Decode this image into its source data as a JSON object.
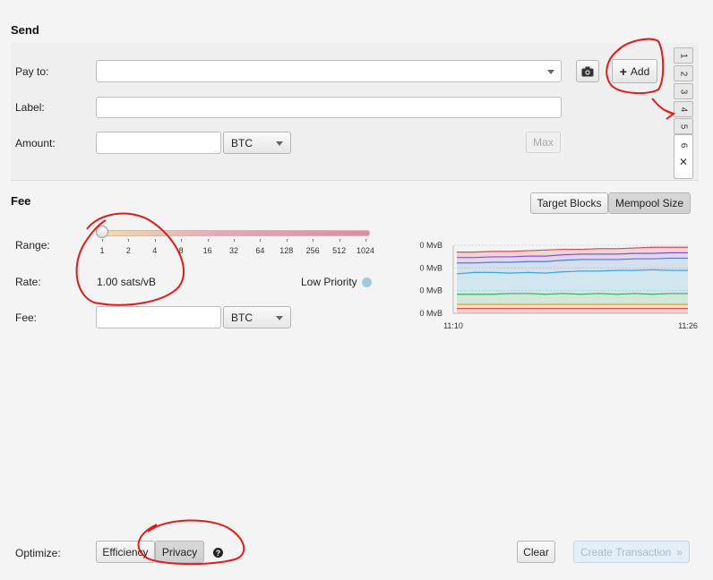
{
  "send": {
    "title": "Send",
    "pay_to_label": "Pay to:",
    "pay_to_value": "",
    "label_label": "Label:",
    "label_value": "",
    "amount_label": "Amount:",
    "amount_value": "",
    "amount_unit": "BTC",
    "max_label": "Max",
    "add_label": "Add",
    "tabs": [
      "1",
      "2",
      "3",
      "4",
      "5",
      "6"
    ],
    "close_symbol": "✕"
  },
  "fee": {
    "title": "Fee",
    "toggle": [
      "Target Blocks",
      "Mempool Size"
    ],
    "toggle_selected": "Mempool Size",
    "range_label": "Range:",
    "range_ticks": [
      "1",
      "2",
      "4",
      "8",
      "16",
      "32",
      "64",
      "128",
      "256",
      "512",
      "1024"
    ],
    "slider_position": 0,
    "rate_label": "Rate:",
    "rate_value": "1.00 sats/vB",
    "priority_label": "Low Priority",
    "priority_color": "#9ecbe0",
    "fee_label": "Fee:",
    "fee_value": "",
    "fee_unit": "BTC"
  },
  "chart_data": {
    "type": "area",
    "y_tick_labels": [
      "0 MvB",
      "0 MvB",
      "0 MvB",
      "0 MvB"
    ],
    "x_tick_labels": [
      "11:10",
      "11:26"
    ],
    "grid": true,
    "series": [
      {
        "color": "#d24d57",
        "values": [
          0.1,
          0.1,
          0.09,
          0.09,
          0.08,
          0.07,
          0.06,
          0.06,
          0.05,
          0.05,
          0.04,
          0.03,
          0.03,
          0.03
        ]
      },
      {
        "color": "#8a4fd0",
        "values": [
          0.18,
          0.18,
          0.17,
          0.17,
          0.16,
          0.16,
          0.14,
          0.13,
          0.13,
          0.13,
          0.12,
          0.12,
          0.11,
          0.11
        ]
      },
      {
        "color": "#4a7fd4",
        "values": [
          0.26,
          0.26,
          0.25,
          0.25,
          0.24,
          0.24,
          0.22,
          0.21,
          0.21,
          0.21,
          0.2,
          0.2,
          0.19,
          0.19
        ]
      },
      {
        "color": "#3aa8d8",
        "values": [
          0.42,
          0.4,
          0.4,
          0.41,
          0.4,
          0.41,
          0.39,
          0.38,
          0.38,
          0.37,
          0.37,
          0.36,
          0.37,
          0.37
        ]
      },
      {
        "color": "#3cae5a",
        "values": [
          0.72,
          0.72,
          0.72,
          0.71,
          0.71,
          0.72,
          0.71,
          0.72,
          0.71,
          0.72,
          0.71,
          0.72,
          0.71,
          0.71
        ]
      },
      {
        "color": "#e3a23b",
        "values": [
          0.87,
          0.87,
          0.87,
          0.87,
          0.87,
          0.87,
          0.87,
          0.87,
          0.87,
          0.87,
          0.87,
          0.87,
          0.87,
          0.87
        ]
      },
      {
        "color": "#d9383a",
        "values": [
          0.93,
          0.93,
          0.93,
          0.93,
          0.93,
          0.93,
          0.93,
          0.93,
          0.93,
          0.93,
          0.93,
          0.93,
          0.93,
          0.93
        ]
      }
    ]
  },
  "optimize": {
    "label": "Optimize:",
    "options": [
      "Efficiency",
      "Privacy"
    ],
    "selected": "Privacy",
    "help_symbol": "?",
    "clear_label": "Clear",
    "create_label": "Create Transaction",
    "create_arrows": "»"
  }
}
